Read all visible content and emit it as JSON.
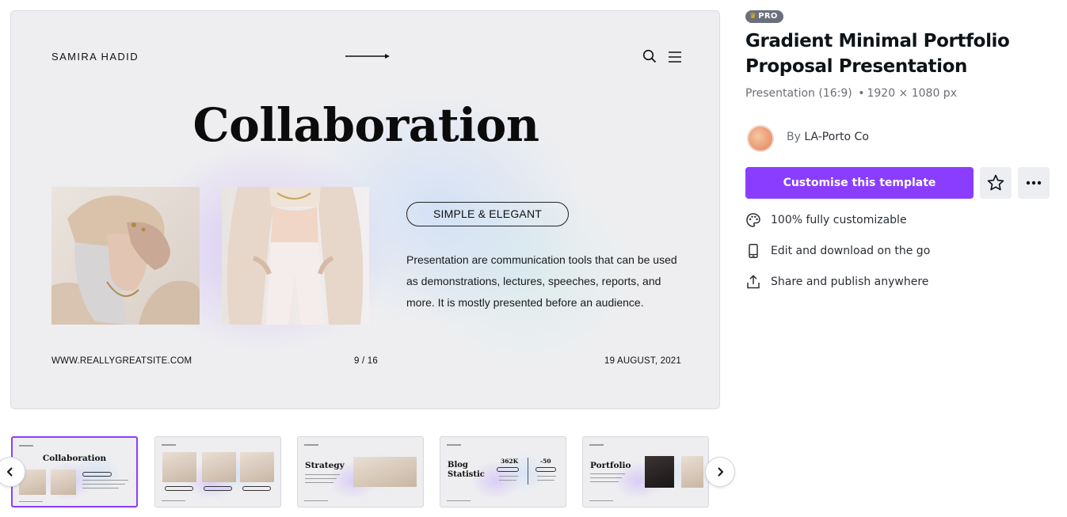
{
  "slide": {
    "brand": "SAMIRA HADID",
    "title": "Collaboration",
    "pill": "SIMPLE & ELEGANT",
    "body": "Presentation are communication tools that can be used as demonstrations, lectures, speeches, reports, and more. It is mostly presented before an audience.",
    "website": "WWW.REALLYGREATSITE.COM",
    "page": "9 / 16",
    "date": "19 AUGUST, 2021"
  },
  "panel": {
    "badge": "PRO",
    "title": "Gradient Minimal Portfolio Proposal Presentation",
    "format": "Presentation (16:9)",
    "dimensions": "1920 × 1080 px",
    "by": "By",
    "author": "LA-Porto Co",
    "customise_label": "Customise this template",
    "features": [
      {
        "icon": "palette-icon",
        "label": "100% fully customizable"
      },
      {
        "icon": "phone-icon",
        "label": "Edit and download on the go"
      },
      {
        "icon": "share-icon",
        "label": "Share and publish anywhere"
      }
    ]
  },
  "thumbnails": [
    {
      "title": "Collaboration",
      "active": true
    },
    {
      "title": "",
      "active": false
    },
    {
      "title": "Strategy",
      "active": false
    },
    {
      "title": "Blog Statistic",
      "stat1": "362K",
      "stat2": "-50",
      "active": false
    },
    {
      "title": "Portfolio",
      "active": false
    }
  ],
  "colors": {
    "accent": "#8b3dff",
    "badge": "#6b6f7c",
    "crown": "#f7b500",
    "slide_bg": "#eeeef0"
  }
}
